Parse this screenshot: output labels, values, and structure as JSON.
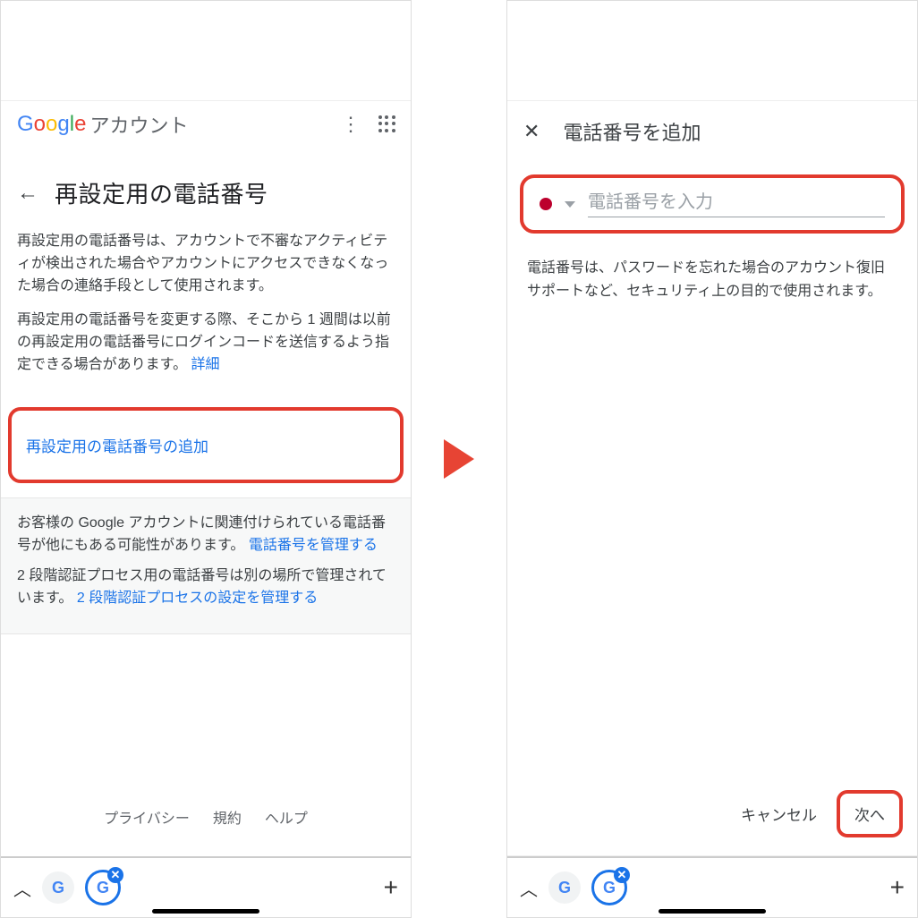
{
  "left": {
    "logo_letters": [
      "G",
      "o",
      "o",
      "g",
      "l",
      "e"
    ],
    "account_label": "アカウント",
    "page_title": "再設定用の電話番号",
    "para1": "再設定用の電話番号は、アカウントで不審なアクティビティが検出された場合やアカウントにアクセスできなくなった場合の連絡手段として使用されます。",
    "para2_a": "再設定用の電話番号を変更する際、そこから 1 週間は以前の再設定用の電話番号にログインコードを送信するよう指定できる場合があります。",
    "para2_link": "詳細",
    "add_link": "再設定用の電話番号の追加",
    "info1_a": "お客様の Google アカウントに関連付けられている電話番号が他にもある可能性があります。",
    "info1_link": "電話番号を管理する",
    "info2_a": "2 段階認証プロセス用の電話番号は別の場所で管理されています。",
    "info2_link": "2 段階認証プロセスの設定を管理する",
    "footer": {
      "privacy": "プライバシー",
      "terms": "規約",
      "help": "ヘルプ"
    }
  },
  "right": {
    "title": "電話番号を追加",
    "placeholder": "電話番号を入力",
    "desc": "電話番号は、パスワードを忘れた場合のアカウント復旧サポートなど、セキュリティ上の目的で使用されます。",
    "cancel": "キャンセル",
    "next": "次へ"
  },
  "browser": {
    "g_letters": [
      "G"
    ],
    "g_multi": [
      "G",
      "o",
      "o",
      "g",
      "l",
      "e"
    ]
  },
  "colors": {
    "highlight": "#e23a2e",
    "link": "#1a73e8"
  }
}
